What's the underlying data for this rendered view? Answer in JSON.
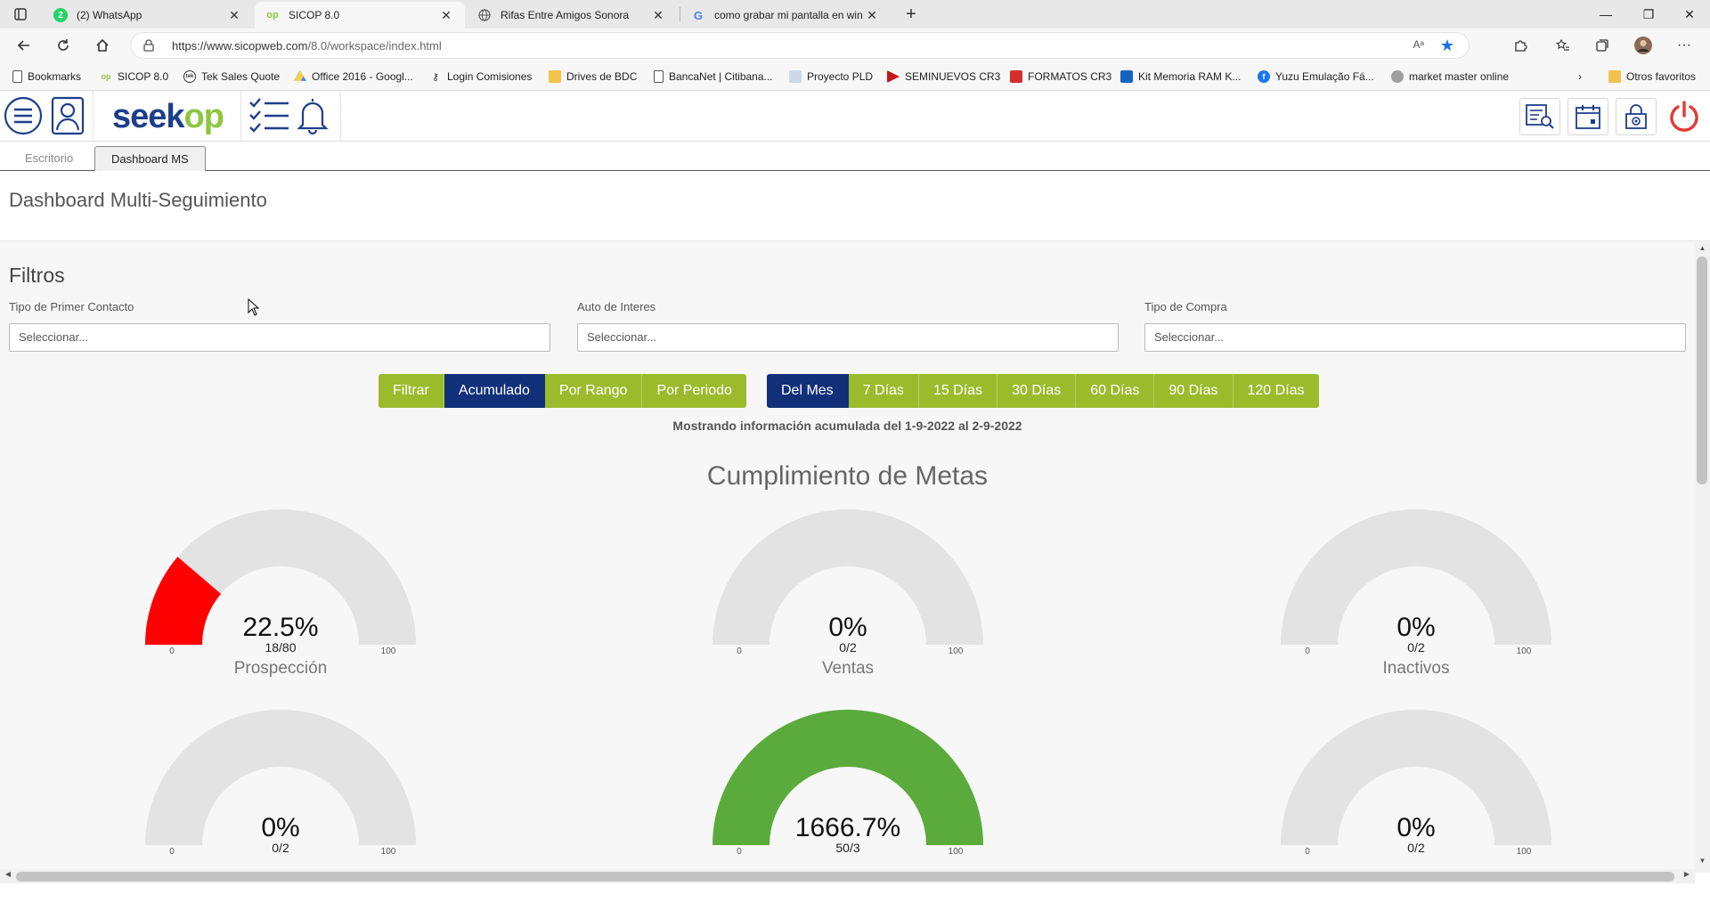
{
  "browser": {
    "tabs": [
      {
        "title": "(2) WhatsApp",
        "active": false
      },
      {
        "title": "SICOP 8.0",
        "active": true
      },
      {
        "title": "Rifas Entre Amigos Sonora",
        "active": false
      },
      {
        "title": "como grabar mi pantalla en win",
        "active": false
      }
    ],
    "url_host": "https://www.sicopweb.com",
    "url_path": "/8.0/workspace/index.html",
    "read_aloud": "Aᵃ",
    "bookmarks": [
      "Bookmarks",
      "SICOP 8.0",
      "Tek Sales Quote",
      "Office 2016 - Googl...",
      "Login Comisiones",
      "Drives de BDC",
      "BancaNet | Citibana...",
      "Proyecto PLD",
      "SEMINUEVOS CR3",
      "FORMATOS CR3",
      "Kit Memoria RAM K...",
      "Yuzu Emulação Fá...",
      "market master online"
    ],
    "other_bookmarks": "Otros favoritos"
  },
  "app": {
    "logo_a": "seek",
    "logo_b": "op",
    "tabs": [
      "Escritorio",
      "Dashboard MS"
    ],
    "page_title": "Dashboard Multi-Seguimiento",
    "filters": {
      "heading": "Filtros",
      "fields": [
        {
          "label": "Tipo de Primer Contacto",
          "placeholder": "Seleccionar..."
        },
        {
          "label": "Auto de Interes",
          "placeholder": "Seleccionar..."
        },
        {
          "label": "Tipo de Compra",
          "placeholder": "Seleccionar..."
        }
      ]
    },
    "buttons_mode": [
      "Filtrar",
      "Acumulado",
      "Por Rango",
      "Por Periodo"
    ],
    "buttons_range": [
      "Del Mes",
      "7 Días",
      "15 Días",
      "30 Días",
      "60 Días",
      "90 Días",
      "120 Días"
    ],
    "showing": "Mostrando información acumulada del 1-9-2022 al 2-9-2022",
    "section_title": "Cumplimiento de Metas",
    "gauges": [
      {
        "pct": "22.5%",
        "frac": "18/80",
        "label": "Prospección",
        "value": 22.5,
        "color": "#ff0000",
        "min": "0",
        "max": "100"
      },
      {
        "pct": "0%",
        "frac": "0/2",
        "label": "Ventas",
        "value": 0,
        "color": "#ff0000",
        "min": "0",
        "max": "100"
      },
      {
        "pct": "0%",
        "frac": "0/2",
        "label": "Inactivos",
        "value": 0,
        "color": "#ff0000",
        "min": "0",
        "max": "100"
      },
      {
        "pct": "0%",
        "frac": "0/2",
        "label": "",
        "value": 0,
        "color": "#ff0000",
        "min": "0",
        "max": "100"
      },
      {
        "pct": "1666.7%",
        "frac": "50/3",
        "label": "",
        "value": 100,
        "color": "#5aab3b",
        "min": "0",
        "max": "100"
      },
      {
        "pct": "0%",
        "frac": "0/2",
        "label": "",
        "value": 0,
        "color": "#ff0000",
        "min": "0",
        "max": "100"
      }
    ]
  }
}
